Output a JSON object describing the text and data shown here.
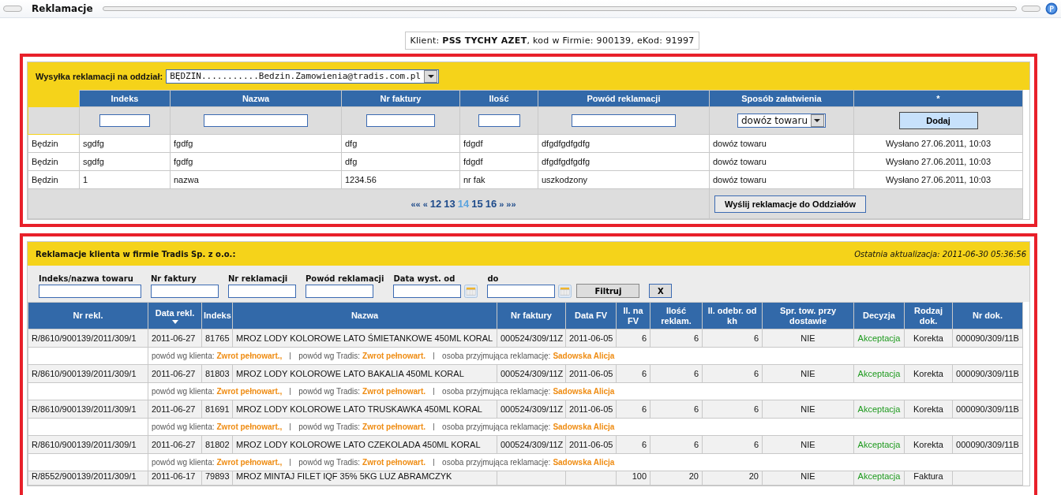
{
  "window": {
    "title": "Reklamacje"
  },
  "client_info": {
    "label": "Klient:",
    "name": "PSS TYCHY AZET",
    "rest": ", kod w Firmie: 900139, eKod: 91997"
  },
  "send_form": {
    "branch_label": "Wysyłka reklamacji na oddział:",
    "branch_value": "BĘDZIN...........Bedzin.Zamowienia@tradis.com.pl",
    "columns": [
      "",
      "Indeks",
      "Nazwa",
      "Nr faktury",
      "Ilość",
      "Powód reklamacji",
      "Sposób załatwienia",
      "*"
    ],
    "resolution_value": "dowóz towaru",
    "add_button": "Dodaj",
    "rows": [
      [
        "Będzin",
        "sgdfg",
        "fgdfg",
        "dfg",
        "fdgdf",
        "dfgdfgdfgdfg",
        "dowóz towaru",
        "Wysłano 27.06.2011, 10:03"
      ],
      [
        "Będzin",
        "sgdfg",
        "fgdfg",
        "dfg",
        "fdgdf",
        "dfgdfgdfgdfg",
        "dowóz towaru",
        "Wysłano 27.06.2011, 10:03"
      ],
      [
        "Będzin",
        "1",
        "nazwa",
        "1234.56",
        "nr fak",
        "uszkodzony",
        "dowóz towaru",
        "Wysłano 27.06.2011, 10:03"
      ]
    ],
    "pager": {
      "first": "««",
      "prev": "«",
      "pages": [
        {
          "label": "12",
          "selected": false
        },
        {
          "label": "13",
          "selected": false
        },
        {
          "label": "14",
          "selected": true
        },
        {
          "label": "15",
          "selected": false
        },
        {
          "label": "16",
          "selected": false
        }
      ],
      "next": "»",
      "last": "»»"
    },
    "send_button": "Wyślij reklamacje do Oddziałów"
  },
  "complaints": {
    "title": "Reklamacje klienta w firmie Tradis Sp. z o.o.:",
    "last_update": "Ostatnia aktualizacja: 2011-06-30 05:36:56",
    "filters": [
      {
        "label": "Indeks/nazwa towaru",
        "calendar": false
      },
      {
        "label": "Nr faktury",
        "calendar": false
      },
      {
        "label": "Nr reklamacji",
        "calendar": false
      },
      {
        "label": "Powód reklamacji",
        "calendar": false
      },
      {
        "label": "Data wyst. od",
        "calendar": true
      },
      {
        "label": "do",
        "calendar": true
      }
    ],
    "filter_button": "Filtruj",
    "clear_button": "X",
    "columns": [
      {
        "label": "Nr rekl.",
        "sorted": false
      },
      {
        "label": "Data rekl.",
        "sorted": true
      },
      {
        "label": "Indeks",
        "sorted": false
      },
      {
        "label": "Nazwa",
        "sorted": false
      },
      {
        "label": "Nr faktury",
        "sorted": false
      },
      {
        "label": "Data FV",
        "sorted": false
      },
      {
        "label": "Il. na FV",
        "sorted": false
      },
      {
        "label": "Ilość reklam.",
        "sorted": false
      },
      {
        "label": "Il. odebr. od kh",
        "sorted": false
      },
      {
        "label": "Spr. tow. przy dostawie",
        "sorted": false
      },
      {
        "label": "Decyzja",
        "sorted": false
      },
      {
        "label": "Rodzaj dok.",
        "sorted": false
      },
      {
        "label": "Nr dok.",
        "sorted": false
      }
    ],
    "rows": [
      {
        "cells": [
          "R/8610/900139/2011/309/1",
          "2011-06-27",
          "81765",
          "MROZ LODY KOLOROWE LATO ŚMIETANKOWE 450ML KORAL",
          "000524/309/11Z",
          "2011-06-05",
          "6",
          "6",
          "6",
          "NIE",
          "Akceptacja",
          "Korekta",
          "000090/309/11B"
        ],
        "details": [
          {
            "label": "powód wg klienta:",
            "value": "Zwrot pełnowart.,"
          },
          {
            "label": "powód wg Tradis:",
            "value": "Zwrot pełnowart."
          },
          {
            "label": "osoba przyjmująca reklamację:",
            "value": "Sadowska Alicja"
          }
        ]
      },
      {
        "cells": [
          "R/8610/900139/2011/309/1",
          "2011-06-27",
          "81803",
          "MROZ LODY KOLOROWE LATO BAKALIA 450ML KORAL",
          "000524/309/11Z",
          "2011-06-05",
          "6",
          "6",
          "6",
          "NIE",
          "Akceptacja",
          "Korekta",
          "000090/309/11B"
        ],
        "details": [
          {
            "label": "powód wg klienta:",
            "value": "Zwrot pełnowart.,"
          },
          {
            "label": "powód wg Tradis:",
            "value": "Zwrot pełnowart."
          },
          {
            "label": "osoba przyjmująca reklamację:",
            "value": "Sadowska Alicja"
          }
        ]
      },
      {
        "cells": [
          "R/8610/900139/2011/309/1",
          "2011-06-27",
          "81691",
          "MROZ LODY KOLOROWE LATO TRUSKAWKA 450ML KORAL",
          "000524/309/11Z",
          "2011-06-05",
          "6",
          "6",
          "6",
          "NIE",
          "Akceptacja",
          "Korekta",
          "000090/309/11B"
        ],
        "details": [
          {
            "label": "powód wg klienta:",
            "value": "Zwrot pełnowart.,"
          },
          {
            "label": "powód wg Tradis:",
            "value": "Zwrot pełnowart."
          },
          {
            "label": "osoba przyjmująca reklamację:",
            "value": "Sadowska Alicja"
          }
        ]
      },
      {
        "cells": [
          "R/8610/900139/2011/309/1",
          "2011-06-27",
          "81802",
          "MROZ LODY KOLOROWE LATO CZEKOLADA 450ML KORAL",
          "000524/309/11Z",
          "2011-06-05",
          "6",
          "6",
          "6",
          "NIE",
          "Akceptacja",
          "Korekta",
          "000090/309/11B"
        ],
        "details": [
          {
            "label": "powód wg klienta:",
            "value": "Zwrot pełnowart.,"
          },
          {
            "label": "powód wg Tradis:",
            "value": "Zwrot pełnowart."
          },
          {
            "label": "osoba przyjmująca reklamację:",
            "value": "Sadowska Alicja"
          }
        ]
      },
      {
        "cells": [
          "R/8552/900139/2011/309/1",
          "2011-06-17",
          "79893",
          "MROZ MINTAJ FILET IQF 35% 5KG LUZ ABRAMCZYK",
          "",
          "",
          "100",
          "20",
          "20",
          "NIE",
          "Akceptacja",
          "Faktura",
          ""
        ],
        "details": []
      }
    ]
  }
}
